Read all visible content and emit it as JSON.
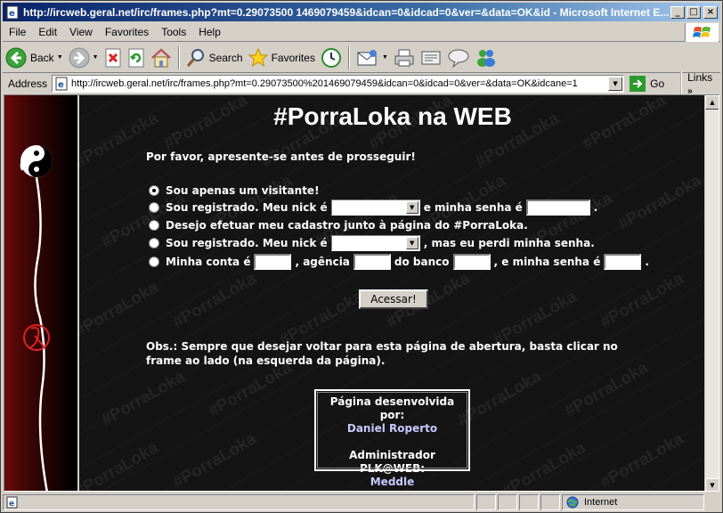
{
  "window": {
    "title": "http://ircweb.geral.net/irc/frames.php?mt=0.29073500 1469079459&idcan=0&idcad=0&ver=&data=OK&id - Microsoft Internet E...",
    "minimize": "_",
    "maximize": "□",
    "close": "×"
  },
  "menu": {
    "file": "File",
    "edit": "Edit",
    "view": "View",
    "favorites": "Favorites",
    "tools": "Tools",
    "help": "Help"
  },
  "toolbar": {
    "back": "Back",
    "search": "Search",
    "favorites": "Favorites"
  },
  "address": {
    "label": "Address",
    "url": "http://ircweb.geral.net/irc/frames.php?mt=0.29073500%201469079459&idcan=0&idcad=0&ver=&data=OK&idcane=1",
    "go": "Go",
    "links": "Links"
  },
  "page": {
    "title": "#PorraLoka na WEB",
    "prompt": "Por favor, apresente-se antes de prosseguir!",
    "watermark": "#PorraLoka",
    "options": {
      "visitor": "Sou apenas um visitante!",
      "registered_nick": "Sou registrado. Meu nick é",
      "and_password": "e minha senha é",
      "period": ".",
      "register": "Desejo efetuar meu cadastro junto à página do #PorraLoka.",
      "lost_password_nick": "Sou registrado. Meu nick é",
      "lost_password_tail": ", mas eu perdi minha senha.",
      "account": "Minha conta é",
      "agency": ", agência",
      "bank": "do banco",
      "account_password": ", e minha senha é",
      "account_period": "."
    },
    "selected_option": "visitor",
    "submit": "Acessar!",
    "note": "Obs.: Sempre que desejar voltar para esta página de abertura, basta clicar no frame ao lado (na esquerda da página).",
    "credits": {
      "developed_by_label": "Página desenvolvida por:",
      "developer": "Daniel Roperto",
      "admin_label": "Administrador PLK@WEB:",
      "admin": "Meddle"
    }
  },
  "status": {
    "zone": "Internet"
  }
}
